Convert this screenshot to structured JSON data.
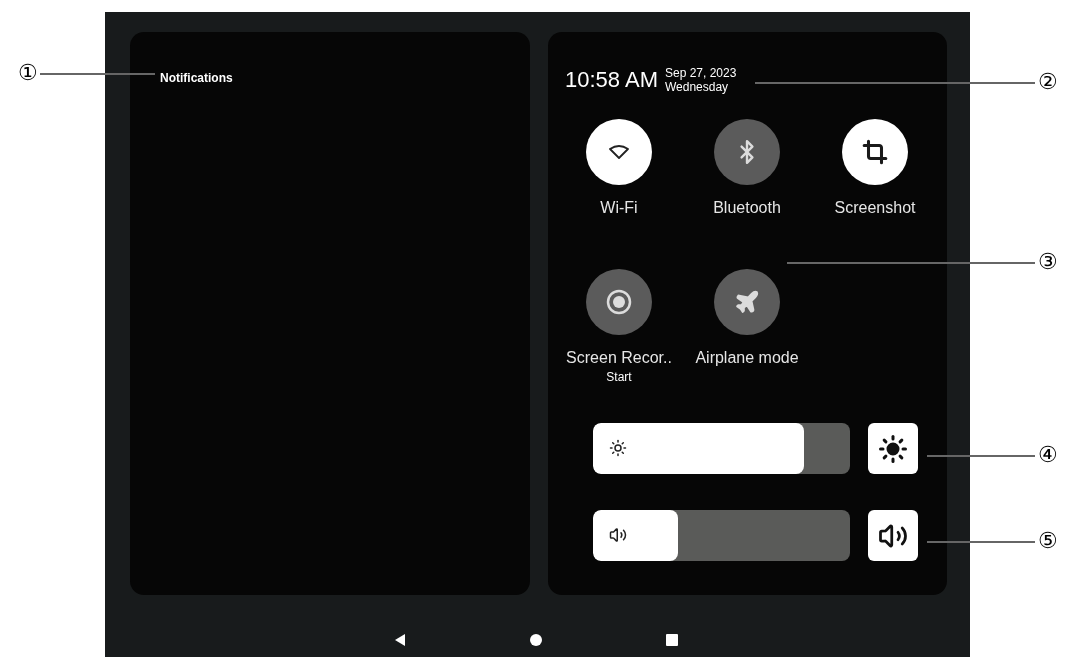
{
  "notifications": {
    "title": "Notifications"
  },
  "quick_settings": {
    "time": "10:58 AM",
    "date": "Sep 27, 2023",
    "weekday": "Wednesday",
    "tiles": [
      {
        "label": "Wi-Fi",
        "on": true
      },
      {
        "label": "Bluetooth",
        "on": false
      },
      {
        "label": "Screenshot",
        "on": true
      },
      {
        "label": "Screen Recor..",
        "sublabel": "Start",
        "on": false
      },
      {
        "label": "Airplane mode",
        "on": false
      }
    ],
    "sliders": [
      {
        "kind": "brightness",
        "level": 0.82
      },
      {
        "kind": "volume",
        "level": 0.33
      }
    ]
  },
  "callouts": [
    "①",
    "②",
    "③",
    "④",
    "⑤"
  ]
}
